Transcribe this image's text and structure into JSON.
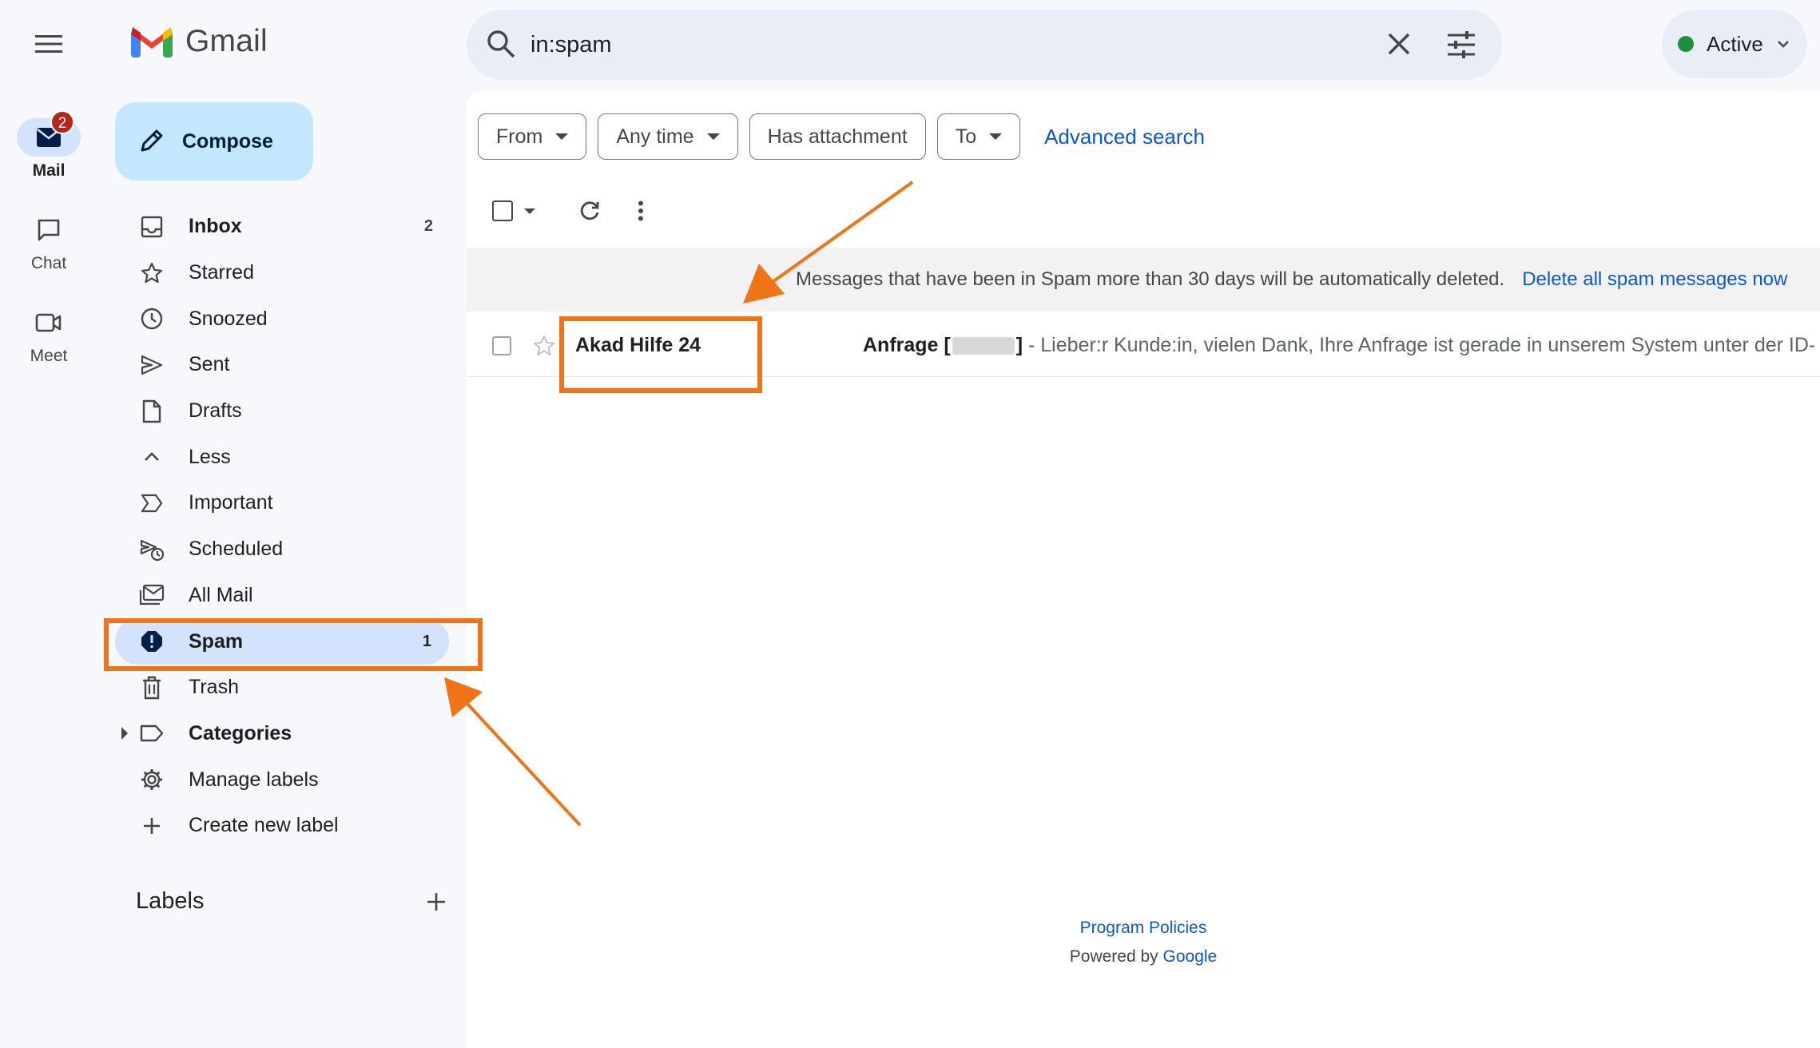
{
  "rail": {
    "menu_icon": "hamburger-menu-icon",
    "items": [
      {
        "label": "Mail",
        "badge": "2",
        "icon": "mail-icon",
        "active": true
      },
      {
        "label": "Chat",
        "icon": "chat-icon",
        "active": false
      },
      {
        "label": "Meet",
        "icon": "meet-icon",
        "active": false
      }
    ]
  },
  "brand": {
    "name": "Gmail"
  },
  "compose": {
    "label": "Compose"
  },
  "nav": [
    {
      "label": "Inbox",
      "count": "2",
      "icon": "inbox-icon",
      "bold": true
    },
    {
      "label": "Starred",
      "icon": "star-icon"
    },
    {
      "label": "Snoozed",
      "icon": "clock-icon"
    },
    {
      "label": "Sent",
      "icon": "send-icon"
    },
    {
      "label": "Drafts",
      "icon": "draft-icon"
    },
    {
      "label": "Less",
      "icon": "chevron-up-icon"
    },
    {
      "label": "Important",
      "icon": "important-icon"
    },
    {
      "label": "Scheduled",
      "icon": "scheduled-icon"
    },
    {
      "label": "All Mail",
      "icon": "all-mail-icon"
    },
    {
      "label": "Spam",
      "count": "1",
      "icon": "spam-icon",
      "active": true
    },
    {
      "label": "Trash",
      "icon": "trash-icon"
    },
    {
      "label": "Categories",
      "icon": "label-icon",
      "bold": true
    },
    {
      "label": "Manage labels",
      "icon": "gear-icon"
    },
    {
      "label": "Create new label",
      "icon": "plus-icon"
    }
  ],
  "labels_section": {
    "title": "Labels"
  },
  "search": {
    "value": "in:spam"
  },
  "status": {
    "label": "Active",
    "color": "#1e8e3e"
  },
  "filters": {
    "chips": [
      {
        "label": "From",
        "dropdown": true
      },
      {
        "label": "Any time",
        "dropdown": true
      },
      {
        "label": "Has attachment",
        "dropdown": false
      },
      {
        "label": "To",
        "dropdown": true
      }
    ],
    "advanced_label": "Advanced search"
  },
  "spam_notice": {
    "text": "Messages that have been in Spam more than 30 days will be automatically deleted.",
    "action": "Delete all spam messages now"
  },
  "messages": [
    {
      "sender": "Akad Hilfe 24",
      "subject_prefix": "Anfrage [",
      "subject_suffix": "]",
      "snippet": " - Lieber:r Kunde:in, vielen Dank, Ihre Anfrage ist gerade in unserem System unter der ID-"
    }
  ],
  "footer": {
    "policies": "Program Policies",
    "powered_prefix": "Powered by ",
    "powered_brand": "Google"
  },
  "colors": {
    "accent": "#0b57d0",
    "highlight": "#f07318",
    "compose_bg": "#c2e7ff",
    "active_nav_bg": "#d3e3fd"
  }
}
